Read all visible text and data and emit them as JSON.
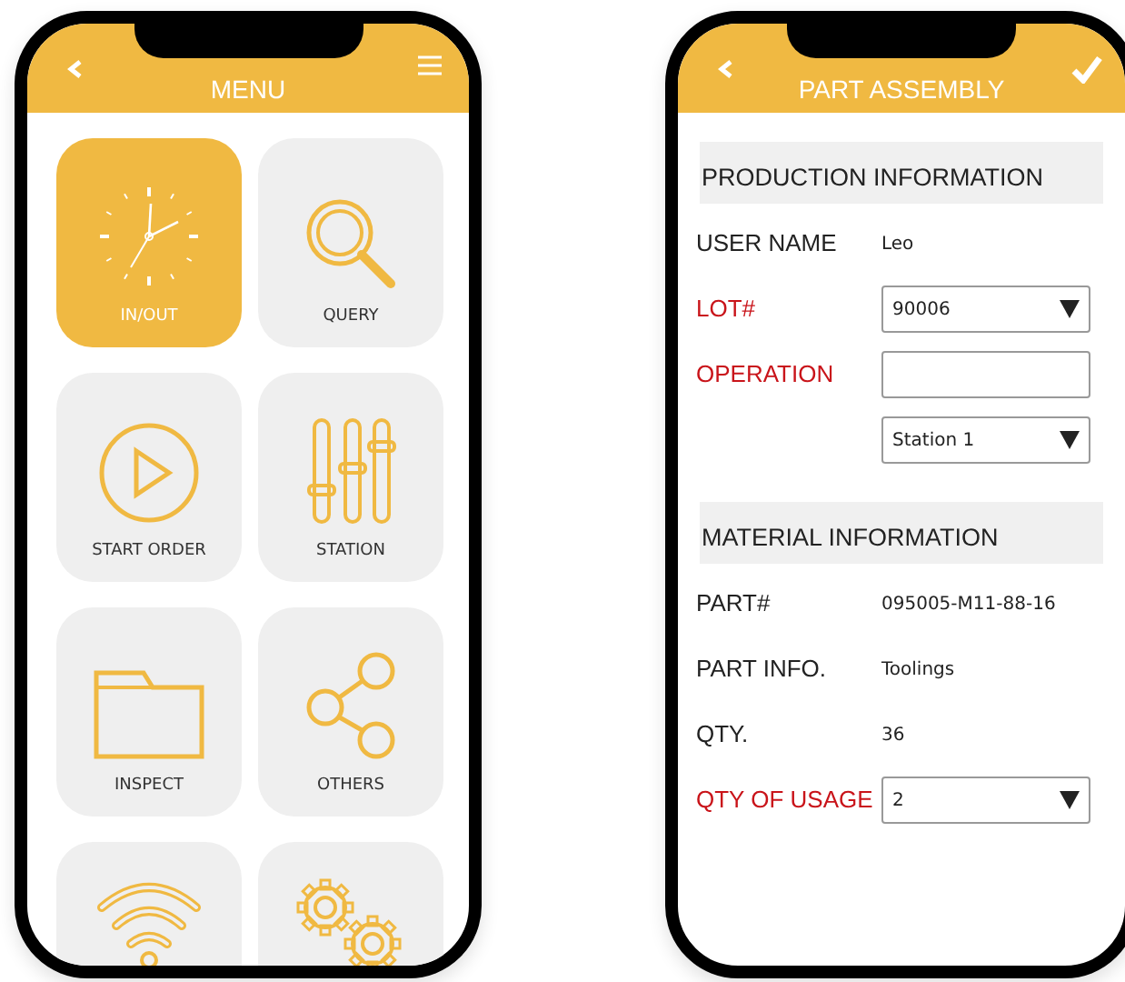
{
  "phones": [
    {
      "kind": "menu",
      "title": "MENU",
      "tiles": [
        {
          "label": "IN/OUT",
          "selected": true
        },
        {
          "label": "QUERY",
          "selected": false
        },
        {
          "label": "START ORDER",
          "selected": false
        },
        {
          "label": "STATION",
          "selected": false
        },
        {
          "label": "INSPECT",
          "selected": false
        },
        {
          "label": "OTHERS",
          "selected": false
        },
        {
          "selected": false
        },
        {
          "selected": false
        }
      ]
    },
    {
      "kind": "form",
      "title": "PART ASSEMBLY",
      "sections": [
        {
          "heading": "PRODUCTION INFORMATION",
          "rows": [
            {
              "kind": "text",
              "label": "USER NAME",
              "required": false,
              "value": "Leo"
            },
            {
              "kind": "select",
              "label": "LOT#",
              "required": true,
              "value": "90006"
            },
            {
              "kind": "input",
              "label": "OPERATION",
              "required": true
            },
            {
              "kind": "select",
              "value": "Station 1"
            }
          ]
        },
        {
          "heading": "MATERIAL INFORMATION",
          "rows": [
            {
              "kind": "text",
              "label": "PART#",
              "required": false,
              "value": "095005-M11-88-16"
            },
            {
              "kind": "text",
              "label": "PART INFO.",
              "required": false,
              "value": "Toolings"
            },
            {
              "kind": "text",
              "label": "QTY.",
              "required": false,
              "value": "36"
            },
            {
              "kind": "select",
              "label": "QTY OF USAGE",
              "required": true,
              "value": "2"
            }
          ]
        }
      ]
    }
  ]
}
